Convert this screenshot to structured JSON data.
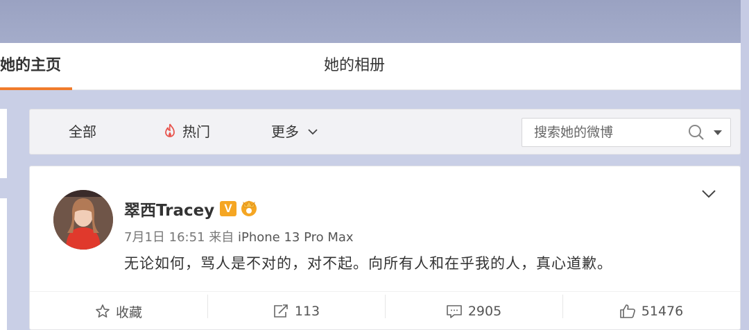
{
  "tabs": {
    "home": "她的主页",
    "album": "她的相册"
  },
  "filter": {
    "all": "全部",
    "hot": "热门",
    "more": "更多",
    "search_placeholder": "搜索她的微博"
  },
  "post": {
    "username": "翠西Tracey",
    "verified_badge": "V",
    "date": "7月1日 16:51",
    "source_prefix": "来自",
    "source": "iPhone 13 Pro Max",
    "text": "无论如何，骂人是不对的，对不起。向所有人和在乎我的人，真心道歉。"
  },
  "actions": {
    "favorite": "收藏",
    "repost_count": "113",
    "comment_count": "2905",
    "like_count": "51476"
  },
  "colors": {
    "accent": "#f07b2b",
    "verified": "#f5a623",
    "hot_icon": "#e8554e"
  },
  "icons": [
    "flame-icon",
    "chevron-down-icon",
    "search-icon",
    "caret-down-icon",
    "star-icon",
    "repost-icon",
    "comment-icon",
    "like-icon"
  ]
}
